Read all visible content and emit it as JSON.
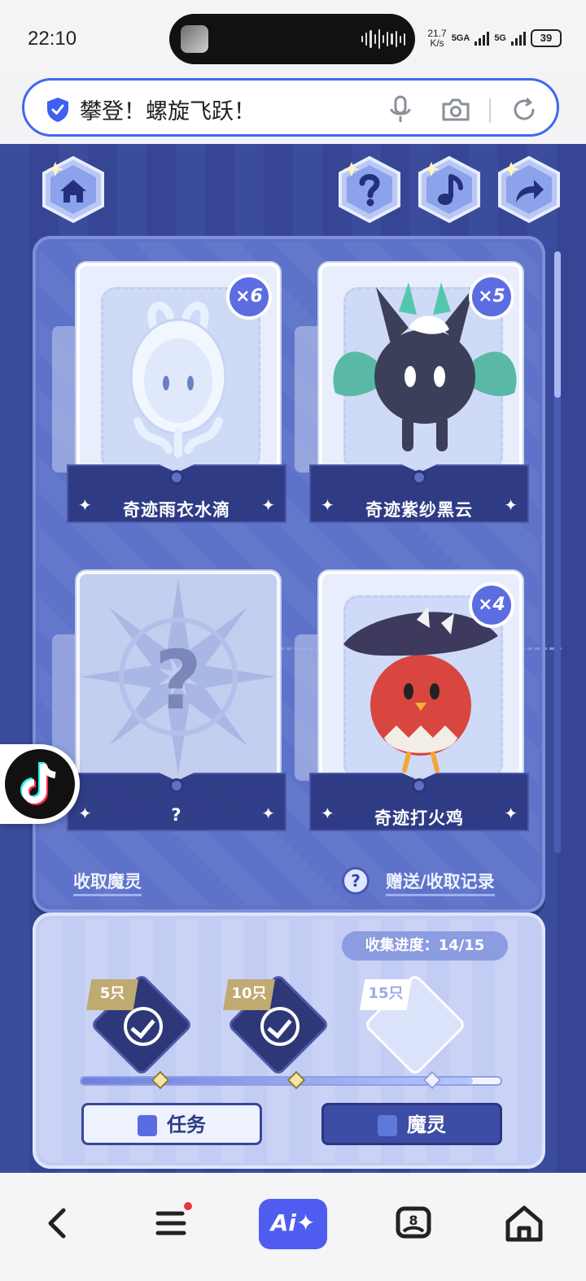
{
  "status_bar": {
    "time": "22:10",
    "net_speed_top": "21.7",
    "net_speed_bottom": "K/s",
    "signal_1": "5GA",
    "signal_2": "5G",
    "battery": "39"
  },
  "search": {
    "text": "攀登！螺旋飞跃！",
    "icons": [
      "shield-icon",
      "mic-icon",
      "camera-icon",
      "refresh-icon"
    ]
  },
  "game": {
    "top_buttons": [
      "home-icon",
      "help-icon",
      "music-icon",
      "share-icon"
    ],
    "cards": [
      {
        "name": "奇迹雨衣水滴",
        "count": "×6"
      },
      {
        "name": "奇迹紫纱黑云",
        "count": "×5"
      },
      {
        "name": "?",
        "locked_glyph": "?"
      },
      {
        "name": "奇迹打火鸡",
        "count": "×4"
      }
    ],
    "links": {
      "collect": "收取魔灵",
      "records": "赠送/收取记录",
      "help_glyph": "?"
    },
    "progress": {
      "label": "收集进度：14/15",
      "value": 14,
      "max": 15,
      "milestones": [
        {
          "tag": "5只",
          "done": true
        },
        {
          "tag": "10只",
          "done": true
        },
        {
          "tag": "15只",
          "done": false
        }
      ]
    },
    "buttons": {
      "task": "任务",
      "spirit": "魔灵"
    },
    "accent_colors": {
      "panel": "#5e72c9",
      "background": "#38489a",
      "badge": "#5b6de0"
    }
  },
  "floating": {
    "icon": "tiktok-icon"
  },
  "bottom_nav": {
    "items": [
      "back-icon",
      "menu-icon",
      "ai-button",
      "reader-icon",
      "home-icon"
    ],
    "ai_label": "Ai✦",
    "reader_badge": "8"
  }
}
